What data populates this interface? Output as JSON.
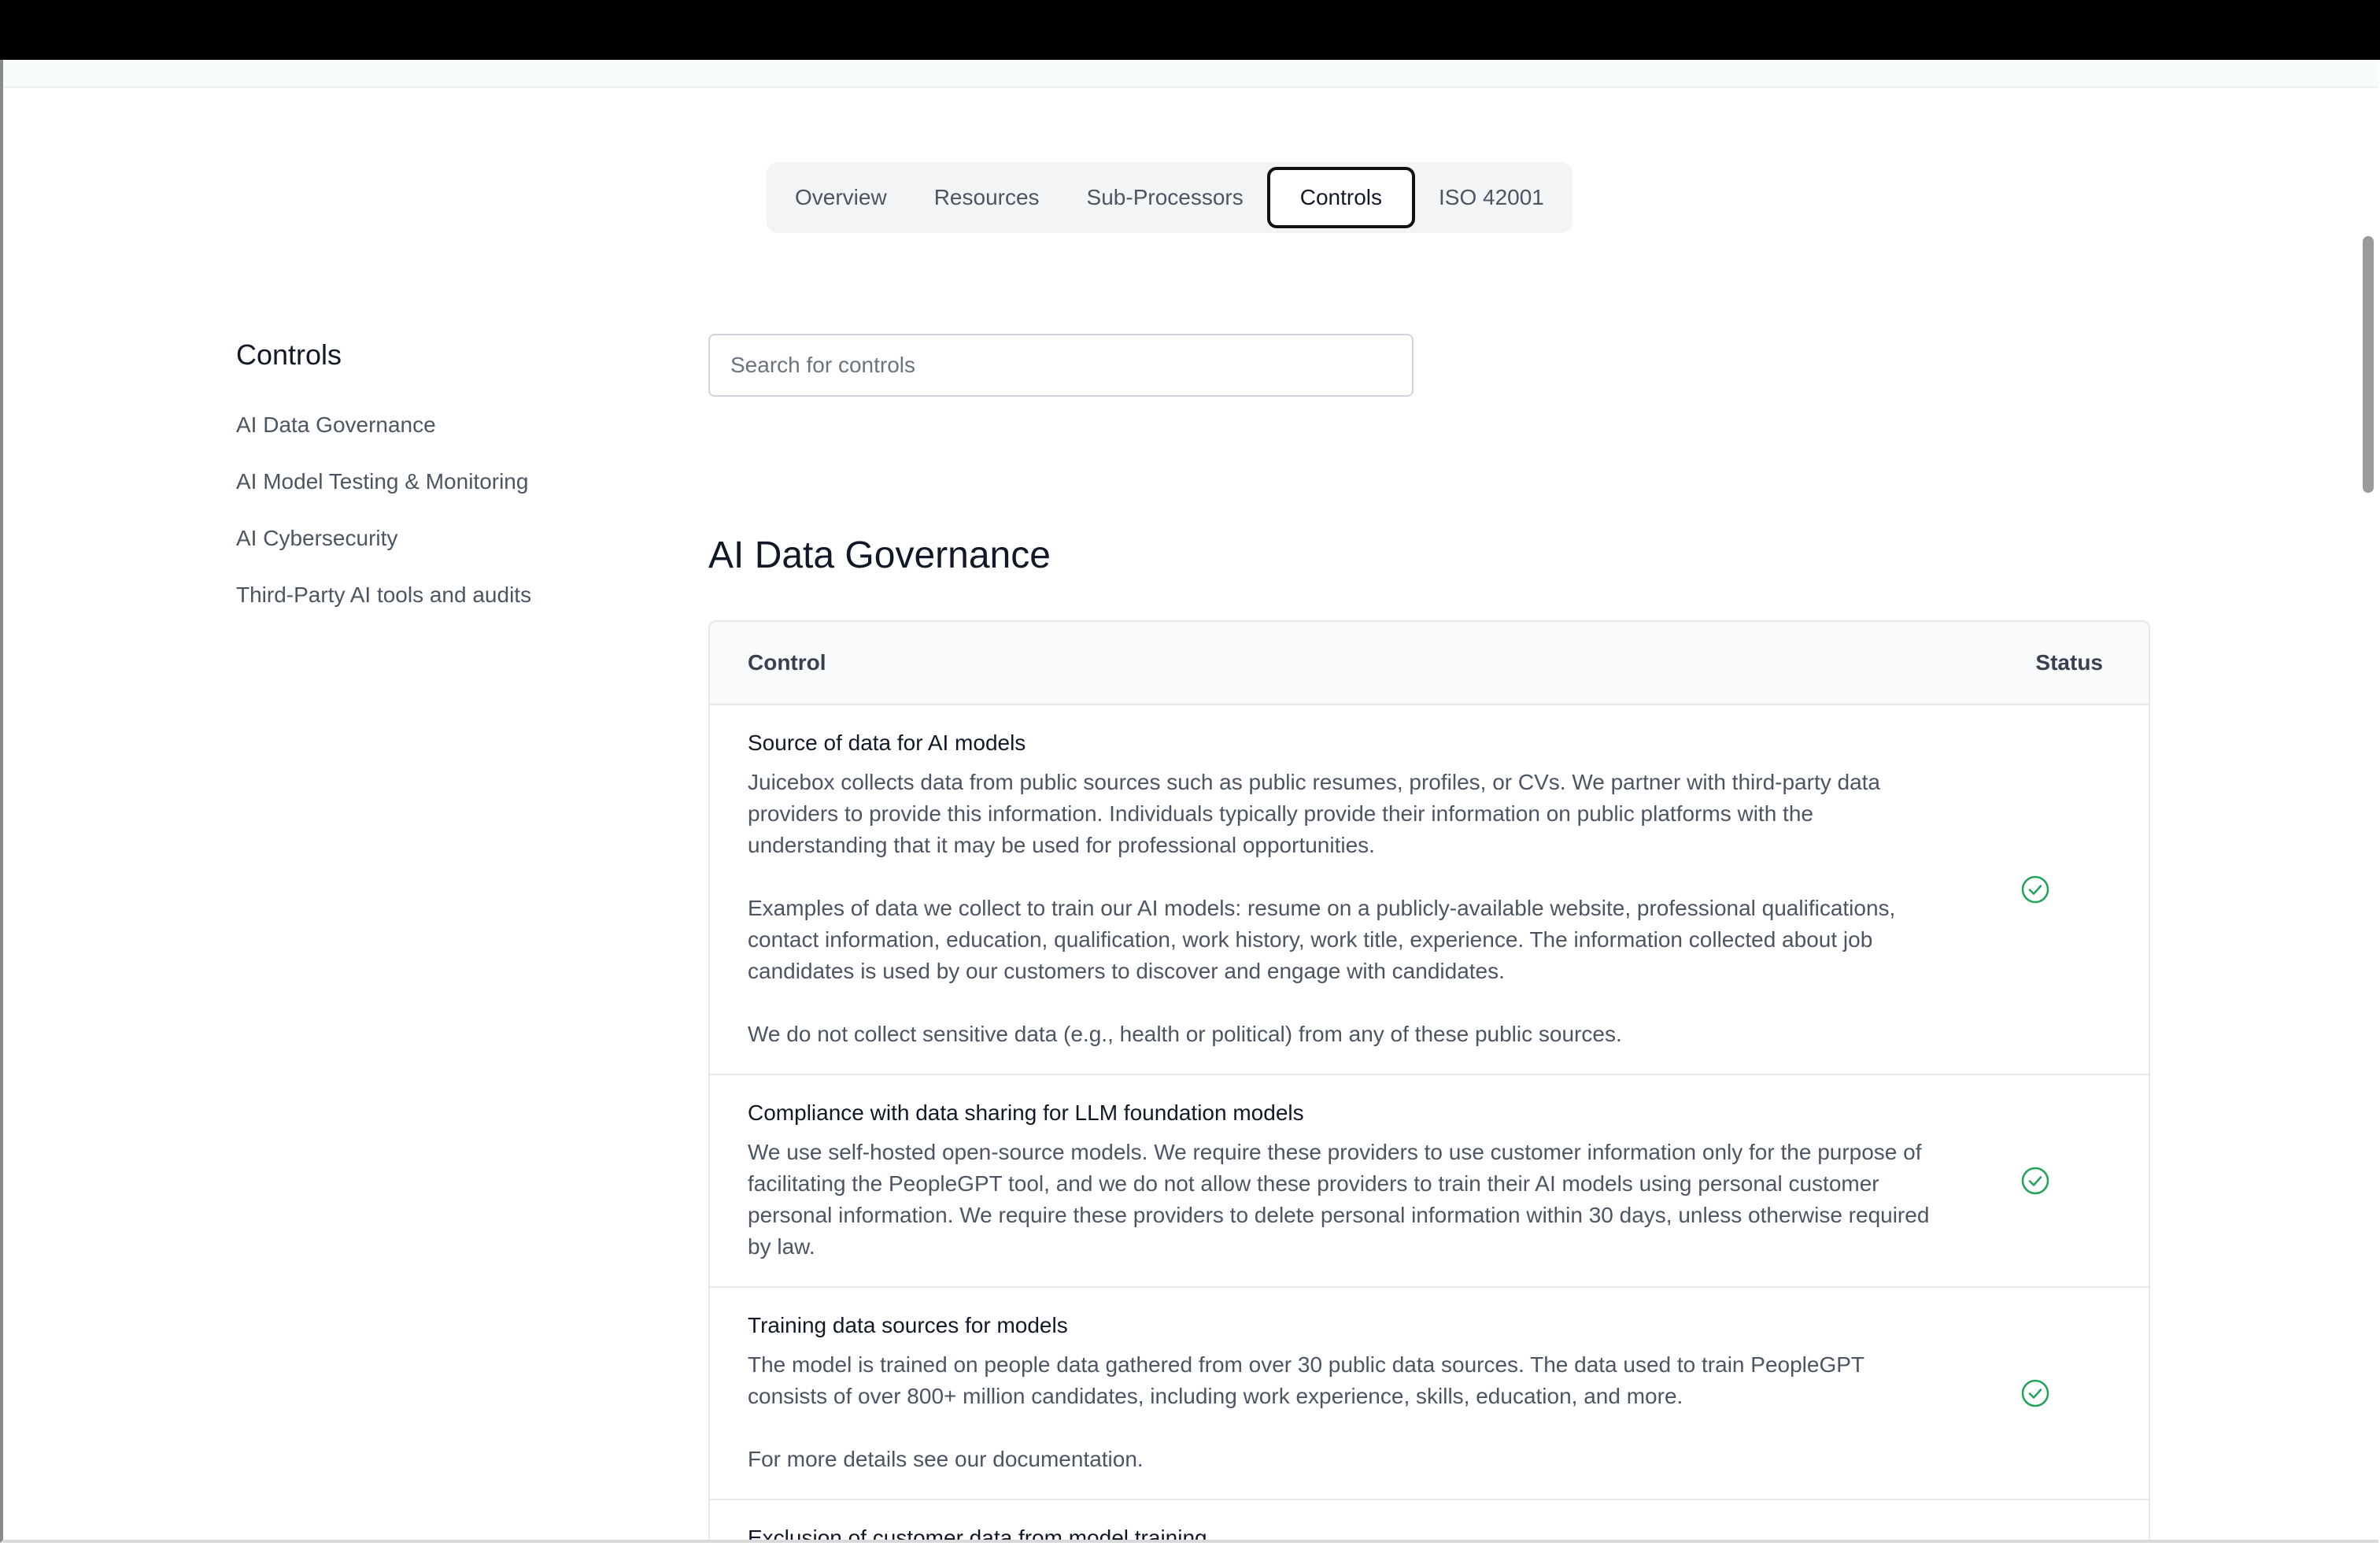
{
  "tabs": [
    {
      "label": "Overview",
      "active": false
    },
    {
      "label": "Resources",
      "active": false
    },
    {
      "label": "Sub-Processors",
      "active": false
    },
    {
      "label": "Controls",
      "active": true
    },
    {
      "label": "ISO 42001",
      "active": false
    }
  ],
  "sidebar": {
    "title": "Controls",
    "items": [
      {
        "label": "AI Data Governance"
      },
      {
        "label": "AI Model Testing & Monitoring"
      },
      {
        "label": "AI Cybersecurity"
      },
      {
        "label": "Third-Party AI tools and audits"
      }
    ]
  },
  "search": {
    "placeholder": "Search for controls",
    "value": ""
  },
  "section": {
    "title": "AI Data Governance"
  },
  "table": {
    "header": {
      "control": "Control",
      "status": "Status"
    },
    "rows": [
      {
        "title": "Source of data for AI models",
        "paragraphs": [
          "Juicebox collects data from public sources such as public resumes, profiles, or CVs. We partner with third-party data providers to provide this information. Individuals typically provide their information on public platforms with the understanding that it may be used for professional opportunities.",
          "Examples of data we collect to train our AI models: resume on a publicly-available website, professional qualifications, contact information, education, qualification, work history, work title, experience. The information collected about job candidates is used by our customers to discover and engage with candidates.",
          "We do not collect sensitive data (e.g., health or political) from any of these public sources."
        ],
        "status_icon": "check-circle-icon"
      },
      {
        "title": "Compliance with data sharing for LLM foundation models",
        "paragraphs": [
          "We use self-hosted open-source models. We require these providers to use customer information only for the purpose of facilitating the PeopleGPT tool, and we do not allow these providers to train their AI models using personal customer personal information. We require these providers to delete personal information within 30 days, unless otherwise required by law."
        ],
        "status_icon": "check-circle-icon"
      },
      {
        "title": "Training data sources for models",
        "paragraphs": [
          "The model is trained on people data gathered from over 30 public data sources. The data used to train PeopleGPT consists of over 800+ million candidates, including work experience, skills, education, and more.",
          "For more details see our documentation."
        ],
        "status_icon": "check-circle-icon"
      },
      {
        "title": "Exclusion of customer data from model training",
        "paragraphs": [],
        "status_icon": ""
      }
    ]
  },
  "colors": {
    "status_green": "#22a35a",
    "active_tab_border": "#111111"
  }
}
